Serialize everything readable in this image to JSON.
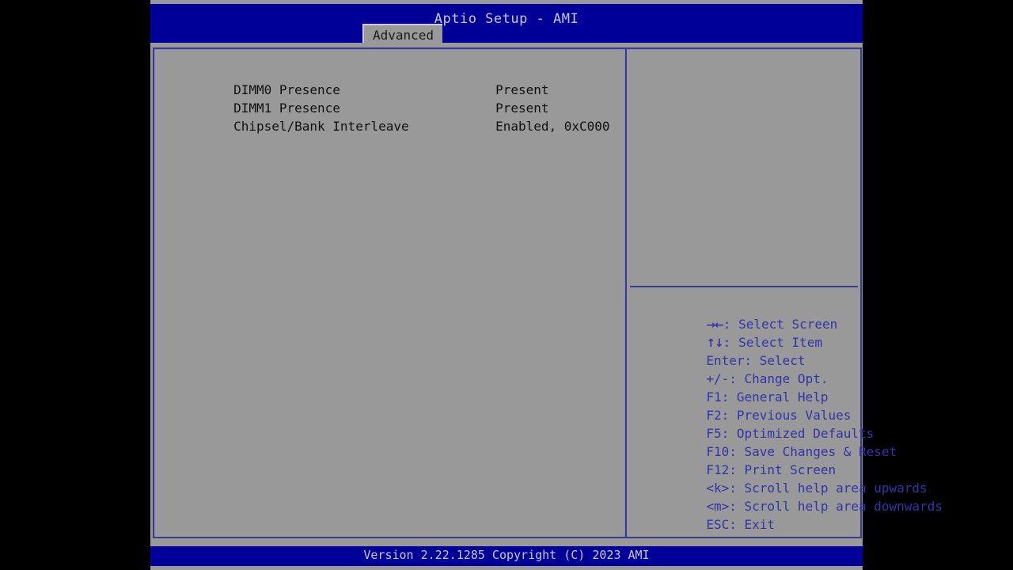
{
  "app": {
    "title": "Aptio Setup - AMI"
  },
  "tabs": [
    {
      "label": "Advanced",
      "active": true
    }
  ],
  "settings": {
    "rows": [
      {
        "label": "DIMM0 Presence",
        "value": "Present"
      },
      {
        "label": "DIMM1 Presence",
        "value": "Present"
      },
      {
        "label": "Chipsel/Bank Interleave",
        "value": "Enabled, 0xC000"
      }
    ]
  },
  "help": {
    "keys": [
      {
        "glyph": "→←",
        "key": "",
        "sep": ": ",
        "text": "Select Screen"
      },
      {
        "glyph": "↑↓",
        "key": "",
        "sep": ": ",
        "text": "Select Item"
      },
      {
        "glyph": "",
        "key": "Enter",
        "sep": ": ",
        "text": "Select"
      },
      {
        "glyph": "",
        "key": "+/-",
        "sep": ": ",
        "text": "Change Opt."
      },
      {
        "glyph": "",
        "key": "F1",
        "sep": ": ",
        "text": "General Help"
      },
      {
        "glyph": "",
        "key": "F2",
        "sep": ": ",
        "text": "Previous Values"
      },
      {
        "glyph": "",
        "key": "F5",
        "sep": ": ",
        "text": "Optimized Defaults"
      },
      {
        "glyph": "",
        "key": "F10",
        "sep": ": ",
        "text": "Save Changes & Reset"
      },
      {
        "glyph": "",
        "key": "F12",
        "sep": ": ",
        "text": "Print Screen"
      },
      {
        "glyph": "",
        "key": "<k>",
        "sep": ": ",
        "text": "Scroll help area upwards"
      },
      {
        "glyph": "",
        "key": "<m>",
        "sep": ": ",
        "text": "Scroll help area downwards"
      },
      {
        "glyph": "",
        "key": "ESC",
        "sep": ": ",
        "text": "Exit"
      }
    ]
  },
  "footer": {
    "version_text": "Version 2.22.1285 Copyright (C) 2023 AMI"
  },
  "colors": {
    "bios_blue": "#000099",
    "bios_gray": "#999999",
    "border_blue": "#3a3a8c",
    "help_text": "#3333aa",
    "title_text": "#c8c8dc",
    "content_text": "#111111",
    "letterbox": "#000000"
  }
}
